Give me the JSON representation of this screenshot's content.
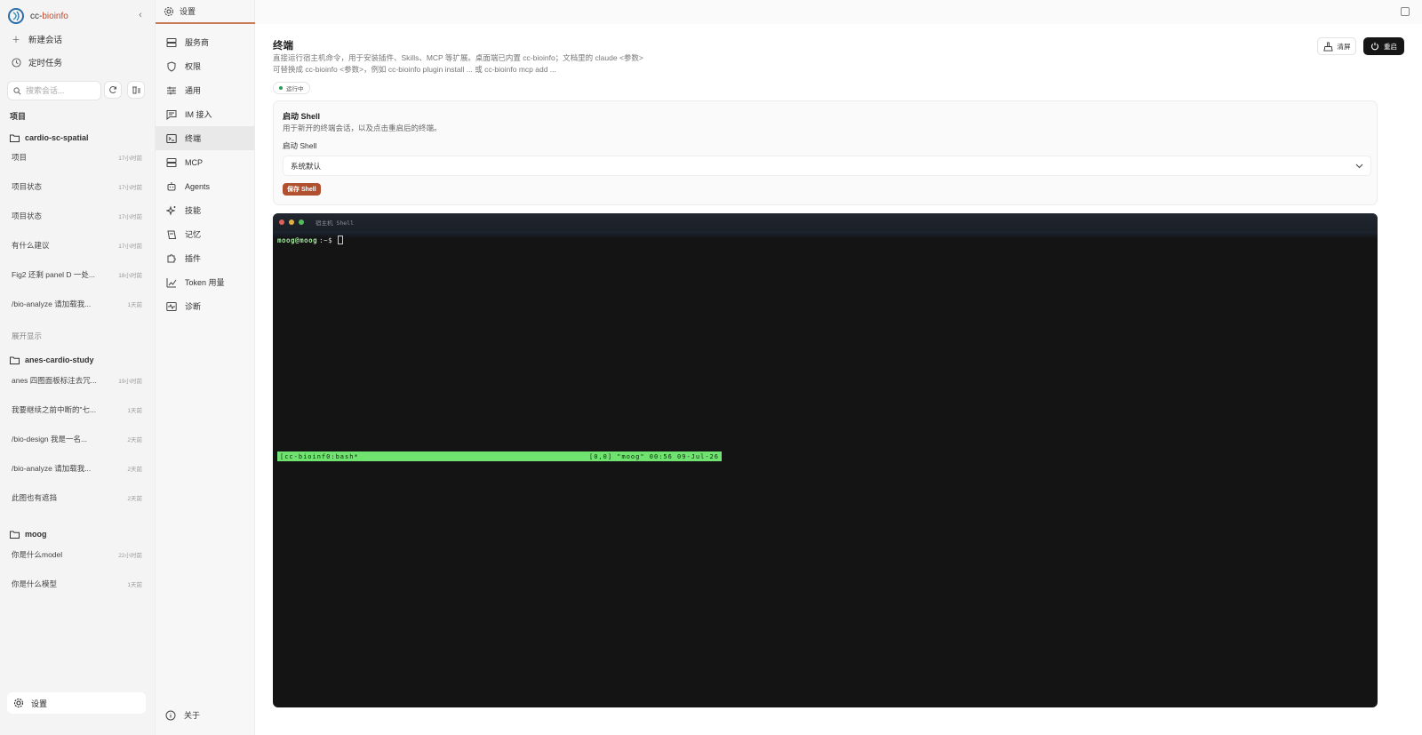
{
  "app": {
    "brand_prefix": "cc-",
    "brand_suffix": "bioinfo"
  },
  "sidebar": {
    "new_chat": "新建会话",
    "scheduled": "定时任务",
    "search_placeholder": "搜索会话...",
    "projects_title": "项目",
    "projects": [
      {
        "name": "cardio-sc-spatial",
        "conversations": [
          {
            "title": "项目",
            "time": "17小时前"
          },
          {
            "title": "项目状态",
            "time": "17小时前"
          },
          {
            "title": "项目状态",
            "time": "17小时前"
          },
          {
            "title": "有什么建议",
            "time": "17小时前"
          },
          {
            "title": "Fig2 还剩 panel D 一处...",
            "time": "18小时前"
          },
          {
            "title": "/bio-analyze 请加载我...",
            "time": "1天前"
          }
        ],
        "expand_label": "展开显示"
      },
      {
        "name": "anes-cardio-study",
        "conversations": [
          {
            "title": "anes 四图面板标注去冗...",
            "time": "19小时前"
          },
          {
            "title": "我要继续之前中断的\"七...",
            "time": "1天前"
          },
          {
            "title": "/bio-design 我是一名...",
            "time": "2天前"
          },
          {
            "title": "/bio-analyze 请加载我...",
            "time": "2天前"
          },
          {
            "title": "此图也有遮挡",
            "time": "2天前"
          }
        ]
      },
      {
        "name": "moog",
        "conversations": [
          {
            "title": "你是什么model",
            "time": "22小时前"
          },
          {
            "title": "你是什么模型",
            "time": "1天前"
          }
        ]
      }
    ],
    "settings_label": "设置"
  },
  "settings_nav": {
    "header": "设置",
    "items": [
      "服务商",
      "权限",
      "通用",
      "IM 接入",
      "终端",
      "MCP",
      "Agents",
      "技能",
      "记忆",
      "插件",
      "Token 用量",
      "诊断"
    ],
    "active_index": 4,
    "about": "关于"
  },
  "main": {
    "title": "终端",
    "description": "直接运行宿主机命令，用于安装插件、Skills、MCP 等扩展。桌面端已内置 cc-bioinfo；文档里的 claude <参数> 可替换成 cc-bioinfo <参数>，例如 cc-bioinfo plugin install ... 或 cc-bioinfo mcp add ...",
    "status": "运行中",
    "clear_label": "清屏",
    "restart_label": "重启",
    "shell_card": {
      "heading": "启动 Shell",
      "desc": "用于新开的终端会话，以及点击重启后的终端。",
      "field_label": "启动 Shell",
      "selected": "系统默认",
      "save_label": "保存 Shell"
    },
    "terminal": {
      "title": "宿主机 Shell",
      "prompt_user": "moog@moog",
      "prompt_path": ":~$",
      "tmux_left": "[cc-bioinf0:bash*",
      "tmux_right": "[0,0] \"moog\" 00:56 09-Jul-26"
    }
  },
  "colors": {
    "accent": "#c0492b",
    "save_button": "#b1502f",
    "status_dot": "#2e9b55",
    "tmux_bar": "#6fe26f",
    "terminal_bg": "#141414"
  }
}
